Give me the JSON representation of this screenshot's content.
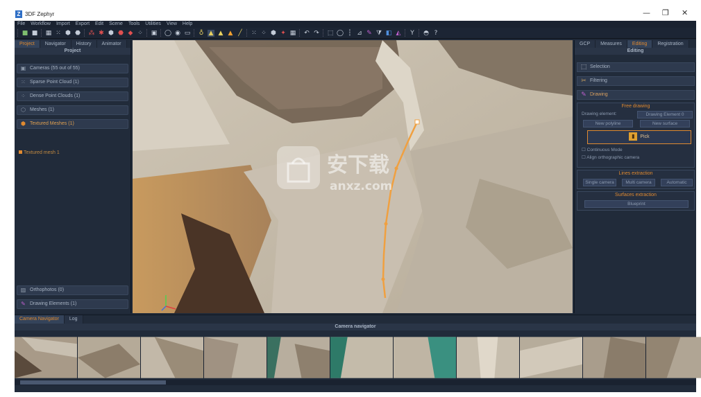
{
  "window": {
    "title": "3DF Zephyr",
    "logo_letter": "Z",
    "minimize": "—",
    "maximize": "❐",
    "close": "✕"
  },
  "menu": [
    "File",
    "Workflow",
    "Import",
    "Export",
    "Edit",
    "Scene",
    "Tools",
    "Utilities",
    "View",
    "Help"
  ],
  "left_panel": {
    "tabs": [
      {
        "label": "Project",
        "active": true
      },
      {
        "label": "Navigator",
        "active": false
      },
      {
        "label": "History",
        "active": false
      },
      {
        "label": "Animator",
        "active": false
      }
    ],
    "header": "Project",
    "items": [
      {
        "label": "Cameras (55 out of 55)",
        "icon": "camera-icon",
        "active": false
      },
      {
        "label": "Sparse Point Cloud (1)",
        "icon": "sparse-cloud-icon",
        "active": false
      },
      {
        "label": "Dense Point Clouds (1)",
        "icon": "dense-cloud-icon",
        "active": false
      },
      {
        "label": "Meshes (1)",
        "icon": "mesh-icon",
        "active": false
      },
      {
        "label": "Textured Meshes (1)",
        "icon": "textured-mesh-icon",
        "active": true
      }
    ],
    "subitem": "Textured mesh 1",
    "bottom_items": [
      {
        "label": "Orthophotos (0)",
        "icon": "orthophoto-icon"
      },
      {
        "label": "Drawing Elements (1)",
        "icon": "drawing-icon"
      }
    ]
  },
  "right_panel": {
    "tabs": [
      {
        "label": "GCP",
        "active": false
      },
      {
        "label": "Measures",
        "active": false
      },
      {
        "label": "Editing",
        "active": true
      },
      {
        "label": "Registration",
        "active": false
      }
    ],
    "header": "Editing",
    "buttons": [
      {
        "label": "Selection",
        "icon": "selection-icon",
        "active": false
      },
      {
        "label": "Filtering",
        "icon": "filtering-icon",
        "active": false
      },
      {
        "label": "Drawing",
        "icon": "drawing-icon",
        "active": true
      }
    ],
    "free_drawing": {
      "title": "Free drawing",
      "element_label": "Drawing element:",
      "element_value": "Drawing Element 0",
      "new_polyline": "New polyline",
      "new_surface": "New surface",
      "pick": "Pick",
      "continuous_mode": "Continuous Mode",
      "align_ortho": "Align orthographic camera"
    },
    "lines_extraction": {
      "title": "Lines extraction",
      "single": "Single camera",
      "multi": "Multi camera",
      "automatic": "Automatic"
    },
    "surfaces_extraction": {
      "title": "Surfaces extraction",
      "blueprint": "Blueprint"
    }
  },
  "bottom_panel": {
    "tabs": [
      {
        "label": "Camera Navigator",
        "active": true
      },
      {
        "label": "Log",
        "active": false
      }
    ],
    "header": "Camera navigator",
    "thumbnail_count": 11
  },
  "watermark": {
    "text": "安下载",
    "subtext": "anxz.com"
  },
  "colors": {
    "accent": "#e08a30",
    "panel_bg": "#212b3a",
    "polyline": "#f0a040"
  }
}
